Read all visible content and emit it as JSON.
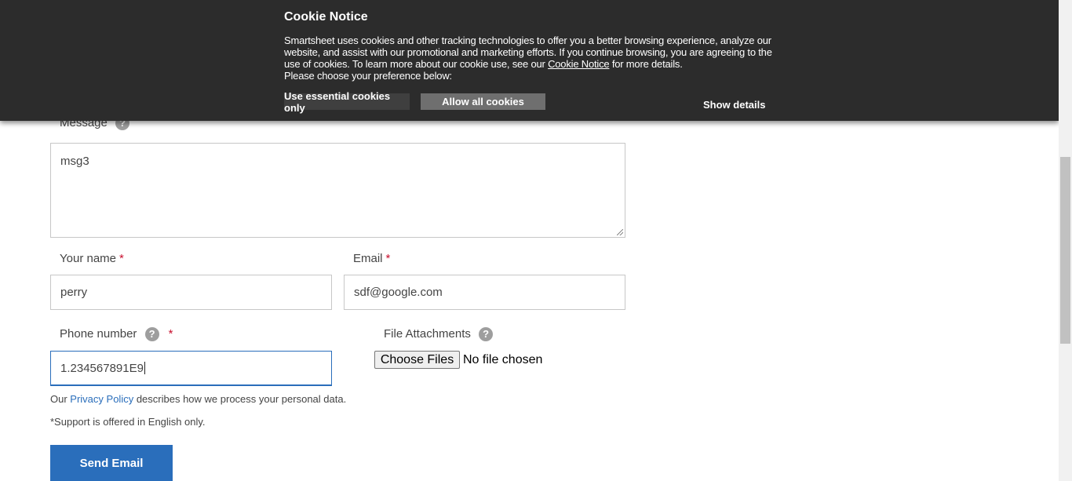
{
  "cookie_banner": {
    "title": "Cookie Notice",
    "text_before_link": "Smartsheet uses cookies and other tracking technologies to offer you a better browsing experience, analyze our website, and assist with our promotional and marketing efforts. If you continue browsing, you are agreeing to the use of cookies. To learn more about our cookie use, see our ",
    "link_text": "Cookie Notice",
    "text_after_link": " for more details.",
    "preference_prompt": "Please choose your preference below:",
    "essential_button": "Use essential cookies only",
    "allow_button": "Allow all cookies",
    "show_details": "Show details"
  },
  "form": {
    "message": {
      "label": "Message",
      "value": "msg3"
    },
    "name": {
      "label": "Your name",
      "required_mark": "*",
      "value": "perry"
    },
    "email": {
      "label": "Email",
      "required_mark": "*",
      "value": "sdf@google.com"
    },
    "phone": {
      "label": "Phone number",
      "required_mark": "*",
      "value": "1.234567891E9"
    },
    "attachments": {
      "label": "File Attachments",
      "button": "Choose Files",
      "status": "No file chosen"
    },
    "help_glyph": "?",
    "privacy": {
      "before": "Our ",
      "link": "Privacy Policy",
      "after": " describes how we process your personal data."
    },
    "support_note": "*Support is offered in English only.",
    "submit_label": "Send Email"
  }
}
